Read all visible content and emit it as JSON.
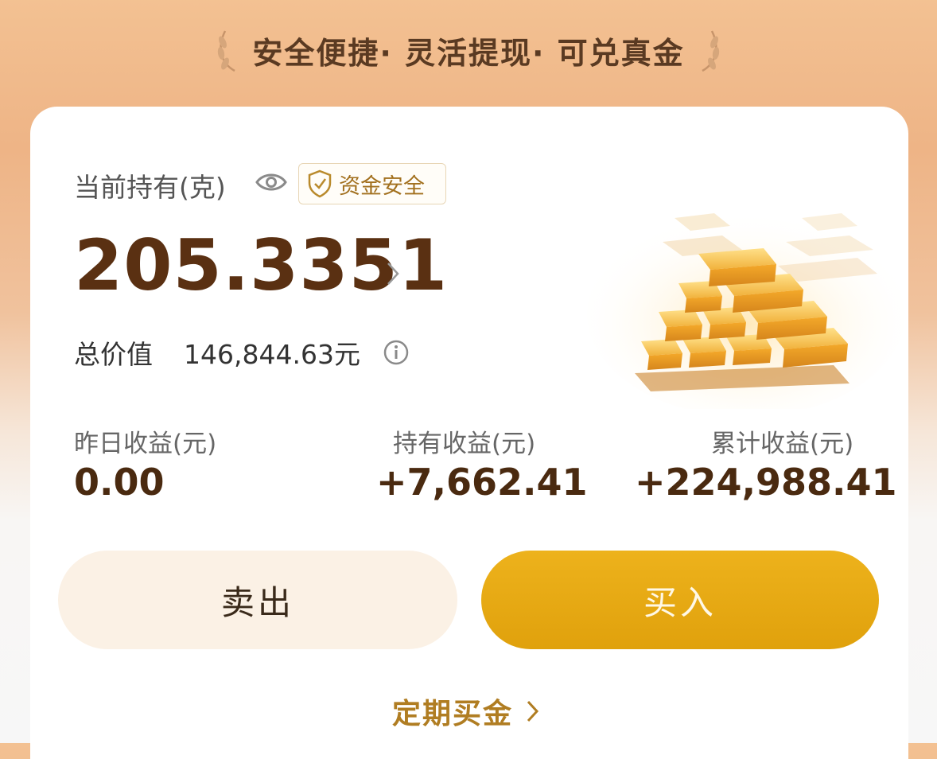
{
  "banner": {
    "slogan": "安全便捷· 灵活提现· 可兑真金"
  },
  "holding": {
    "label": "当前持有(克)",
    "badge": "资金安全",
    "grams": "205.3351",
    "total_label": "总价值",
    "total_value": "146,844.63元"
  },
  "stats": [
    {
      "label": "昨日收益(元)",
      "value": "0.00"
    },
    {
      "label": "持有收益(元)",
      "value": "+7,662.41"
    },
    {
      "label": "累计收益(元)",
      "value": "+224,988.41"
    }
  ],
  "actions": {
    "sell": "卖出",
    "buy": "买入"
  },
  "regular_buy": {
    "label": "定期买金"
  },
  "colors": {
    "accent": "#e0a10c",
    "brown": "#5a3012",
    "link": "#b07d22"
  },
  "icons": [
    "laurel-left-icon",
    "laurel-right-icon",
    "eye-icon",
    "shield-check-icon",
    "chevron-right-icon",
    "info-icon"
  ]
}
